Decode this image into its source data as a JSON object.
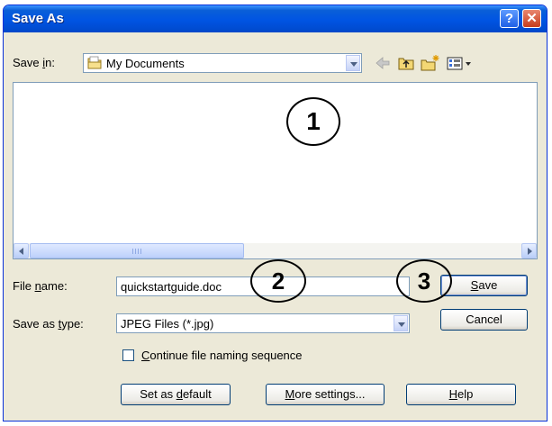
{
  "window": {
    "title": "Save As",
    "help_glyph": "?",
    "close_glyph": "✕",
    "title_color": "#0054e3",
    "face_color": "#ece9d8"
  },
  "save_in": {
    "label_prefix": "Save ",
    "label_accel": "i",
    "label_suffix": "n:",
    "value": "My Documents",
    "icon": "folder-icon"
  },
  "toolbar": {
    "items": [
      "back-arrow-icon",
      "up-folder-icon",
      "new-folder-icon",
      "views-menu-icon"
    ]
  },
  "file_name": {
    "label_prefix": "File ",
    "label_accel": "n",
    "label_suffix": "ame:",
    "value": "quickstartguide.doc"
  },
  "save_as_type": {
    "label_prefix": "Save as ",
    "label_accel": "t",
    "label_suffix": "ype:",
    "value": "JPEG Files (*.jpg)"
  },
  "checkbox": {
    "accel": "C",
    "rest": "ontinue file naming sequence",
    "checked": false
  },
  "buttons": {
    "save_accel": "S",
    "save_rest": "ave",
    "cancel": "Cancel",
    "set_default_pre": "Set as ",
    "set_default_accel": "d",
    "set_default_post": "efault",
    "more_accel": "M",
    "more_rest": "ore settings...",
    "help_accel": "H",
    "help_rest": "elp"
  },
  "callouts": {
    "one": "1",
    "two": "2",
    "three": "3"
  }
}
